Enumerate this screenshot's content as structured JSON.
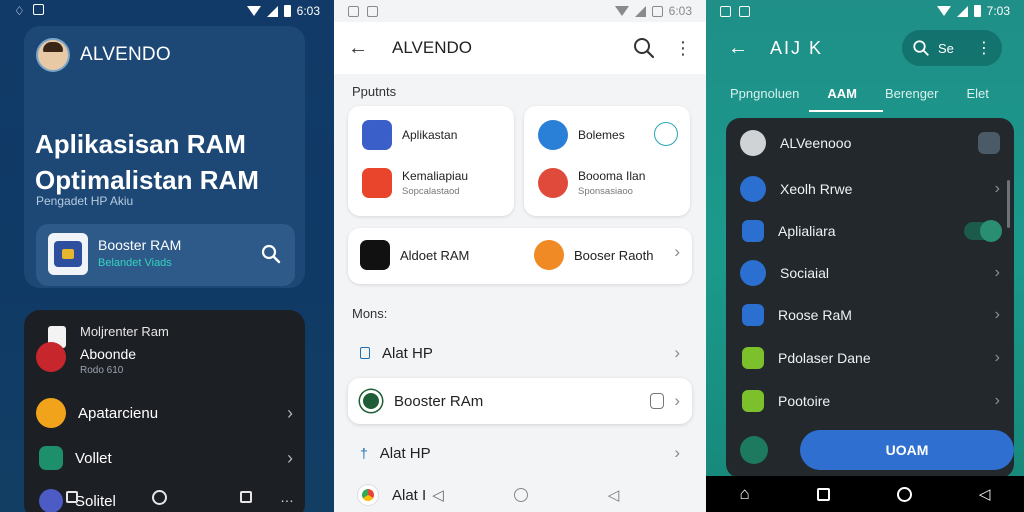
{
  "panel1": {
    "status": {
      "time": "6:03"
    },
    "brand": "ALVENDO",
    "headline": "Aplikasisan RAM Optimalistan RAM",
    "subline": "Pengadet HP Akiu",
    "booster": {
      "title": "Booster RAM",
      "subtitle": "Belandet Viads"
    },
    "list": {
      "top": {
        "line1": "Moljrenter Ram",
        "line2": "Aboonde",
        "line3": "Rodo 610"
      },
      "items": [
        {
          "label": "Apatarcienu",
          "color": "#f2a31c"
        },
        {
          "label": "Vollet",
          "color": "#1e8f6b"
        },
        {
          "label": "Solitel",
          "color": "#4d5bc4"
        }
      ]
    }
  },
  "panel2": {
    "status": {
      "time": "6:03"
    },
    "title": "ALVENDO",
    "section_top": "Pputnts",
    "cards_a": [
      {
        "title": "Aplikastan",
        "subtitle": "",
        "color": "#3b5fc9"
      },
      {
        "title": "Kemaliapiau",
        "subtitle": "Sopcalastaod",
        "color": "#e8452c"
      },
      {
        "title": "Bolemes",
        "subtitle": "",
        "color": "#2a7fd6"
      },
      {
        "title": "Boooma Ilan",
        "subtitle": "Sponsasiaoo",
        "color": "#e04a3a"
      }
    ],
    "card_b": [
      {
        "title": "Aldoet RAM",
        "color": "#111111"
      },
      {
        "title": "Booser Raoth",
        "color": "#f08a24"
      }
    ],
    "section_menu": "Mons:",
    "menu": [
      {
        "label": "Alat HP"
      },
      {
        "label": "Booster RAm"
      },
      {
        "label": "Alat HP"
      },
      {
        "label": "Alat I"
      }
    ]
  },
  "panel3": {
    "status": {
      "time": "7:03"
    },
    "title": "AIJ K",
    "search_text": "Se",
    "tabs": [
      "Ppngnoluen",
      "AAM",
      "Berenger",
      "Elet"
    ],
    "account": "ALVeenooo",
    "items": [
      {
        "label": "Xeolh Rrwe",
        "color": "#2b6fd0"
      },
      {
        "label": "Aplialiara",
        "color": "#2b6fd0"
      },
      {
        "label": "Sociaial",
        "color": "#2b6fd0"
      },
      {
        "label": "Roose RaM",
        "color": "#2b6fd0"
      },
      {
        "label": "Pdolaser Dane",
        "color": "#7cc12c"
      },
      {
        "label": "Pootoire",
        "color": "#7cc12c"
      }
    ],
    "cta": "UOAM"
  }
}
